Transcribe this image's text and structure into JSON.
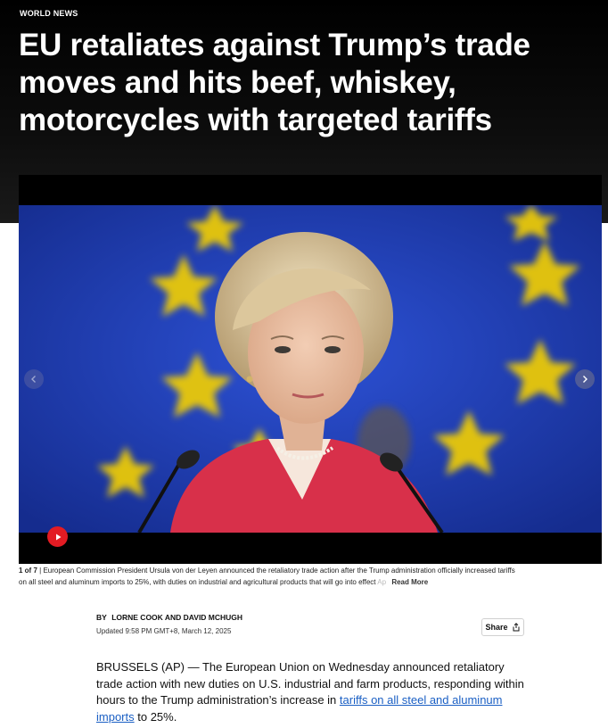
{
  "section": {
    "label": "WORLD NEWS"
  },
  "headline": "EU retaliates against Trump’s trade moves and hits beef, whiskey, motorcycles with targeted tariffs",
  "gallery": {
    "counter": "1 of 7",
    "separator": "|",
    "caption": "European Commission President Ursula von der Leyen announced the retaliatory trade action after the Trump administration officially increased tariffs on all steel and aluminum imports to 25%, with duties on industrial and agricultural products that will go into effect",
    "caption_fade": "Ap",
    "read_more": "Read More",
    "icons": {
      "prev": "chevron-left-icon",
      "next": "chevron-right-icon",
      "play": "play-icon"
    }
  },
  "byline": {
    "prefix": "BY",
    "authors": "LORNE COOK AND DAVID MCHUGH",
    "updated": "Updated 9:58 PM GMT+8, March 12, 2025"
  },
  "share": {
    "label": "Share",
    "icon": "share-icon"
  },
  "article": {
    "p1_before": "BRUSSELS (AP) — The European Union on Wednesday announced retaliatory trade action with new duties on U.S. industrial and farm products, responding within hours to the Trump administration’s increase in ",
    "p1_link": "tariffs on all steel and aluminum imports",
    "p1_after": " to 25%."
  },
  "colors": {
    "header_bg": "#000000",
    "accent_red": "#e31b23",
    "link_blue": "#1a5fc4",
    "eu_blue": "#1d3aa8",
    "eu_star": "#f4d000"
  }
}
